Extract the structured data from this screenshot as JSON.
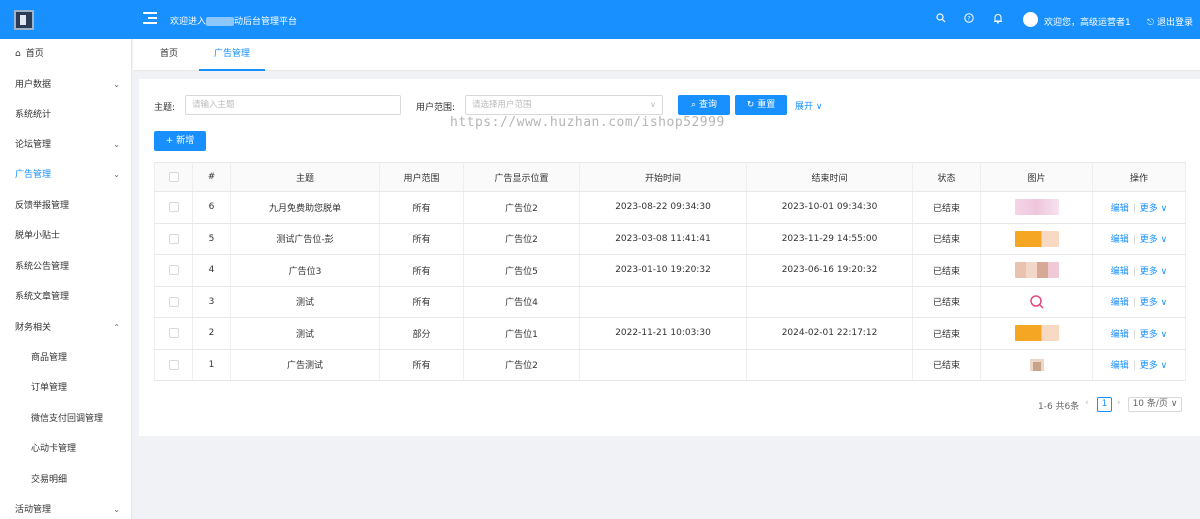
{
  "header": {
    "welcome_prefix": "欢迎进入",
    "welcome_suffix": "动后台管理平台",
    "user_greeting": "欢迎您，高级运营者1",
    "logout_label": "退出登录",
    "icons": [
      "search-icon",
      "help-icon",
      "bell-icon"
    ]
  },
  "sidebar": {
    "items": [
      {
        "label": "首页",
        "icon": "home-icon"
      },
      {
        "label": "用户数据",
        "arrow": "⌄"
      },
      {
        "label": "系统统计"
      },
      {
        "label": "论坛管理",
        "arrow": "⌄"
      },
      {
        "label": "广告管理",
        "arrow": "⌄",
        "active": true
      },
      {
        "label": "反馈举报管理"
      },
      {
        "label": "脱单小贴士"
      },
      {
        "label": "系统公告管理"
      },
      {
        "label": "系统文章管理"
      },
      {
        "label": "财务相关",
        "arrow": "⌃"
      },
      {
        "label": "商品管理",
        "sub": true
      },
      {
        "label": "订单管理",
        "sub": true
      },
      {
        "label": "微信支付回调管理",
        "sub": true
      },
      {
        "label": "心动卡管理",
        "sub": true
      },
      {
        "label": "交易明细",
        "sub": true
      },
      {
        "label": "活动管理",
        "arrow": "⌄"
      }
    ]
  },
  "tabs": [
    {
      "label": "首页"
    },
    {
      "label": "广告管理",
      "active": true
    }
  ],
  "filters": {
    "subject_label": "主题:",
    "subject_placeholder": "请输入主题",
    "scope_label": "用户范围:",
    "scope_placeholder": "请选择用户范围",
    "query_label": "查询",
    "reset_label": "重置",
    "expand_label": "展开"
  },
  "watermark": "https://www.huzhan.com/ishop52999",
  "add_label": "新增",
  "table": {
    "headers": [
      "#",
      "主题",
      "用户范围",
      "广告显示位置",
      "开始时间",
      "结束时间",
      "状态",
      "图片",
      "操作"
    ],
    "rows": [
      {
        "no": "6",
        "subject": "九月免费助您脱单",
        "scope": "所有",
        "position": "广告位2",
        "start": "2023-08-22 09:34:30",
        "end": "2023-10-01 09:34:30",
        "status": "已结束",
        "thumb": "pink"
      },
      {
        "no": "5",
        "subject": "测试广告位-彭",
        "scope": "所有",
        "position": "广告位2",
        "start": "2023-03-08 11:41:41",
        "end": "2023-11-29 14:55:00",
        "status": "已结束",
        "thumb": "orange"
      },
      {
        "no": "4",
        "subject": "广告位3",
        "scope": "所有",
        "position": "广告位5",
        "start": "2023-01-10 19:20:32",
        "end": "2023-06-16 19:20:32",
        "status": "已结束",
        "thumb": "photos"
      },
      {
        "no": "3",
        "subject": "测试",
        "scope": "所有",
        "position": "广告位4",
        "start": "",
        "end": "",
        "status": "已结束",
        "thumb": "search"
      },
      {
        "no": "2",
        "subject": "测试",
        "scope": "部分",
        "position": "广告位1",
        "start": "2022-11-21 10:03:30",
        "end": "2024-02-01 22:17:12",
        "status": "已结束",
        "thumb": "orange"
      },
      {
        "no": "1",
        "subject": "广告测试",
        "scope": "所有",
        "position": "广告位2",
        "start": "",
        "end": "",
        "status": "已结束",
        "thumb": "small"
      }
    ],
    "edit_label": "编辑",
    "more_label": "更多"
  },
  "pagination": {
    "summary": "1-6 共6条",
    "current_page": "1",
    "page_size": "10 条/页"
  },
  "colors": {
    "primary": "#1890ff",
    "sidebar_bg": "#ffffff",
    "page_bg": "#f0f2f5"
  }
}
